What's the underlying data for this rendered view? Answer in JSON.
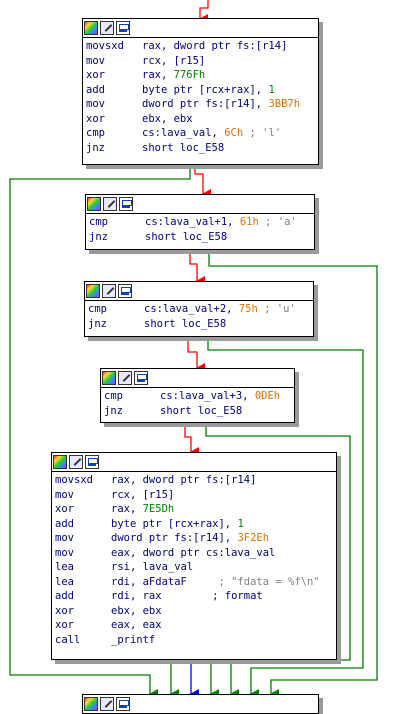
{
  "blocks": [
    {
      "lines": [
        {
          "m": "movsxd",
          "parts": [
            {
              "t": "rax, dword ptr fs:[r14]",
              "c": "ops"
            }
          ]
        },
        {
          "m": "mov",
          "parts": [
            {
              "t": "rcx, [r15]",
              "c": "ops"
            }
          ]
        },
        {
          "m": "xor",
          "parts": [
            {
              "t": "rax, ",
              "c": "ops"
            },
            {
              "t": "776Fh",
              "c": "num"
            }
          ]
        },
        {
          "m": "add",
          "parts": [
            {
              "t": "byte ptr [rcx+rax], ",
              "c": "ops"
            },
            {
              "t": "1",
              "c": "num"
            }
          ]
        },
        {
          "m": "mov",
          "parts": [
            {
              "t": "dword ptr fs:[r14], ",
              "c": "ops"
            },
            {
              "t": "3BB7h",
              "c": "hex"
            }
          ]
        },
        {
          "m": "xor",
          "parts": [
            {
              "t": "ebx, ebx",
              "c": "ops"
            }
          ]
        },
        {
          "m": "cmp",
          "parts": [
            {
              "t": "cs:lava_val, ",
              "c": "ops"
            },
            {
              "t": "6Ch",
              "c": "hex"
            },
            {
              "t": " ; 'l'",
              "c": "cmt"
            }
          ]
        },
        {
          "m": "jnz",
          "parts": [
            {
              "t": "short loc_E58",
              "c": "ops"
            }
          ]
        }
      ]
    },
    {
      "lines": [
        {
          "m": "cmp",
          "parts": [
            {
              "t": "cs:lava_val+1, ",
              "c": "ops"
            },
            {
              "t": "61h",
              "c": "hex"
            },
            {
              "t": " ; 'a'",
              "c": "cmt"
            }
          ]
        },
        {
          "m": "jnz",
          "parts": [
            {
              "t": "short loc_E58",
              "c": "ops"
            }
          ]
        }
      ]
    },
    {
      "lines": [
        {
          "m": "cmp",
          "parts": [
            {
              "t": "cs:lava_val+2, ",
              "c": "ops"
            },
            {
              "t": "75h",
              "c": "hex"
            },
            {
              "t": " ; 'u'",
              "c": "cmt"
            }
          ]
        },
        {
          "m": "jnz",
          "parts": [
            {
              "t": "short loc_E58",
              "c": "ops"
            }
          ]
        }
      ]
    },
    {
      "lines": [
        {
          "m": "cmp",
          "parts": [
            {
              "t": "cs:lava_val+3, ",
              "c": "ops"
            },
            {
              "t": "0DEh",
              "c": "hex"
            }
          ]
        },
        {
          "m": "jnz",
          "parts": [
            {
              "t": "short loc_E58",
              "c": "ops"
            }
          ]
        }
      ]
    },
    {
      "lines": [
        {
          "m": "movsxd",
          "parts": [
            {
              "t": "rax, dword ptr fs:[r14]",
              "c": "ops"
            }
          ]
        },
        {
          "m": "mov",
          "parts": [
            {
              "t": "rcx, [r15]",
              "c": "ops"
            }
          ]
        },
        {
          "m": "xor",
          "parts": [
            {
              "t": "rax, ",
              "c": "ops"
            },
            {
              "t": "7E5Dh",
              "c": "num"
            }
          ]
        },
        {
          "m": "add",
          "parts": [
            {
              "t": "byte ptr [rcx+rax], ",
              "c": "ops"
            },
            {
              "t": "1",
              "c": "num"
            }
          ]
        },
        {
          "m": "mov",
          "parts": [
            {
              "t": "dword ptr fs:[r14], ",
              "c": "ops"
            },
            {
              "t": "3F2Eh",
              "c": "hex"
            }
          ]
        },
        {
          "m": "mov",
          "parts": [
            {
              "t": "eax, dword ptr cs:lava_val",
              "c": "ops"
            }
          ]
        },
        {
          "m": "lea",
          "parts": [
            {
              "t": "rsi, lava_val",
              "c": "ops"
            }
          ]
        },
        {
          "m": "lea",
          "parts": [
            {
              "t": "rdi, aFdataF",
              "c": "ops"
            },
            {
              "t": "     ; \"fdata = %f\\n\"",
              "c": "cmt"
            }
          ]
        },
        {
          "m": "add",
          "parts": [
            {
              "t": "rdi, rax",
              "c": "ops"
            },
            {
              "t": "        ; format",
              "c": "ops"
            }
          ]
        },
        {
          "m": "xor",
          "parts": [
            {
              "t": "ebx, ebx",
              "c": "ops"
            }
          ]
        },
        {
          "m": "xor",
          "parts": [
            {
              "t": "eax, eax",
              "c": "ops"
            }
          ]
        },
        {
          "m": "call",
          "parts": [
            {
              "t": "_printf",
              "c": "ops"
            }
          ]
        }
      ]
    }
  ],
  "colors": {
    "taken": "#008000",
    "not_taken": "#ff0000",
    "unconditional": "#0000ff",
    "shadow": "#9a9a9a"
  },
  "icons": [
    "color-palette-icon",
    "edit-node-icon",
    "graph-overview-icon"
  ]
}
